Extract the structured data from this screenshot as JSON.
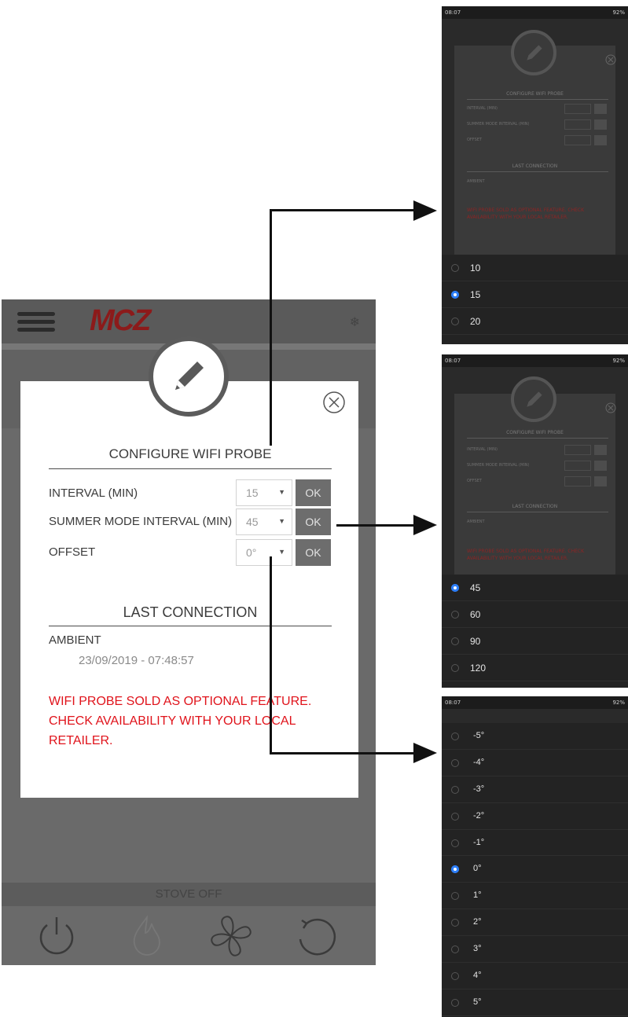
{
  "app": {
    "brand": "MCZ",
    "bottom_status": "STOVE OFF"
  },
  "dialog": {
    "configure_title": "CONFIGURE WIFI PROBE",
    "rows": [
      {
        "label": "INTERVAL (MIN)",
        "value": "15",
        "ok": "OK"
      },
      {
        "label": "SUMMER MODE INTERVAL (MIN)",
        "value": "45",
        "ok": "OK"
      },
      {
        "label": "OFFSET",
        "value": "0°",
        "ok": "OK"
      }
    ],
    "last_connection_title": "LAST CONNECTION",
    "ambient_label": "AMBIENT",
    "ambient_date": "23/09/2019 - 07:48:57",
    "warning": "WIFI PROBE SOLD AS OPTIONAL FEATURE. CHECK AVAILABILITY WITH YOUR LOCAL RETAILER."
  },
  "status_bar": {
    "time": "08:07",
    "right": "92%"
  },
  "interval_options": {
    "selected": "15",
    "options": [
      "10",
      "15",
      "20"
    ]
  },
  "summer_options": {
    "selected": "45",
    "options": [
      "45",
      "60",
      "90",
      "120"
    ]
  },
  "offset_options": {
    "selected": "0°",
    "options": [
      "-5°",
      "-4°",
      "-3°",
      "-2°",
      "-1°",
      "0°",
      "1°",
      "2°",
      "3°",
      "4°",
      "5°"
    ]
  },
  "icons": {
    "menu": "hamburger-icon",
    "snow": "snowflake-icon",
    "edit": "pencil-icon",
    "close": "close-circle-icon",
    "power": "power-icon",
    "flame": "flame-icon",
    "fan": "fan-icon",
    "refresh": "refresh-icon"
  },
  "colors": {
    "warning": "#e0131b",
    "brand": "#8c1a1a",
    "radio_selected": "#2d7ef7"
  }
}
